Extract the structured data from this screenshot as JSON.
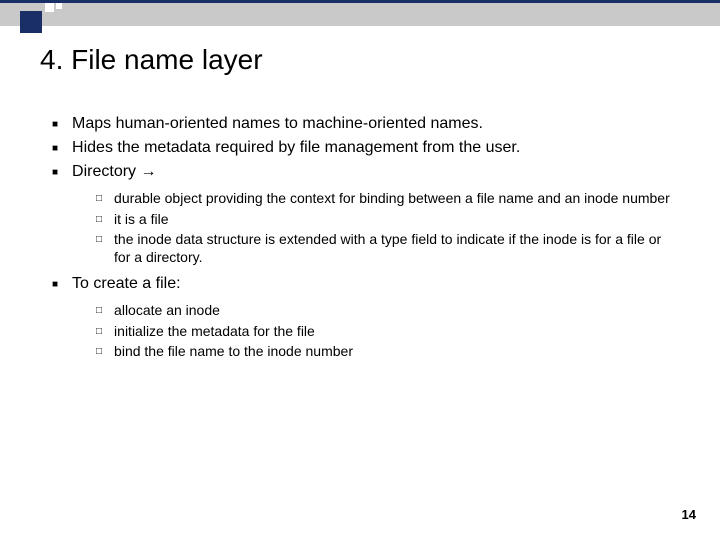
{
  "title": "4.  File name layer",
  "bullets_a": [
    "Maps human-oriented names to machine-oriented names.",
    "Hides the metadata required by file management from the user.",
    "Directory →"
  ],
  "sub_a": [
    "durable object providing the context for binding between  a file name and an inode number",
    "it is a file",
    "the inode data structure is extended with a type field to indicate if the inode is for a file or for a directory."
  ],
  "bullet_b": "To create a file:",
  "sub_b": [
    "allocate an inode",
    "initialize the metadata for the file",
    "bind the file name to the inode number"
  ],
  "page_number": "14"
}
